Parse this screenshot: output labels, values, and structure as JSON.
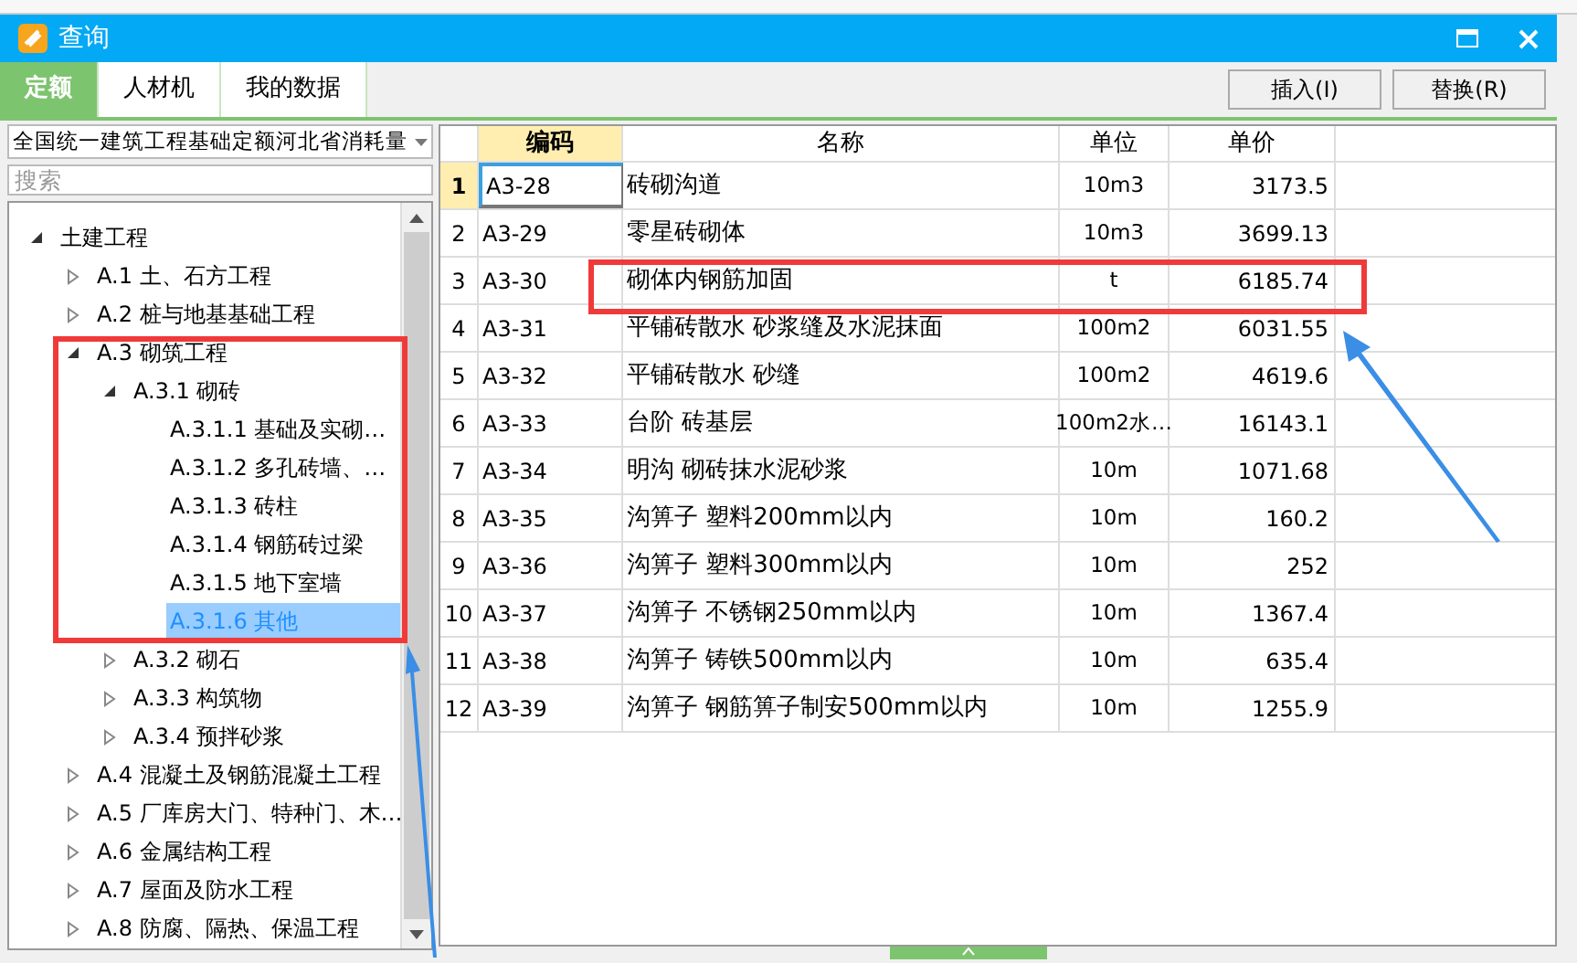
{
  "window": {
    "title": "查询"
  },
  "tabs": [
    {
      "label": "定额",
      "selected": true
    },
    {
      "label": "人材机",
      "selected": false
    },
    {
      "label": "我的数据",
      "selected": false
    }
  ],
  "buttons": [
    "插入(I)",
    "替换(R)"
  ],
  "library_select": {
    "value": "全国统一建筑工程基础定额河北省消耗量"
  },
  "search": {
    "placeholder": "搜索"
  },
  "tree": [
    {
      "label": "土建工程",
      "expanded": true,
      "selected": false,
      "children": [
        {
          "label": "A.1 土、石方工程",
          "expanded": false,
          "selected": false
        },
        {
          "label": "A.2 桩与地基基础工程",
          "expanded": false,
          "selected": false
        },
        {
          "label": "A.3 砌筑工程",
          "expanded": true,
          "selected": false,
          "children": [
            {
              "label": "A.3.1 砌砖",
              "expanded": true,
              "selected": false,
              "children": [
                {
                  "label": "A.3.1.1 基础及实砌…",
                  "selected": false
                },
                {
                  "label": "A.3.1.2 多孔砖墙、…",
                  "selected": false
                },
                {
                  "label": "A.3.1.3 砖柱",
                  "selected": false
                },
                {
                  "label": "A.3.1.4 钢筋砖过梁",
                  "selected": false
                },
                {
                  "label": "A.3.1.5 地下室墙",
                  "selected": false
                },
                {
                  "label": "A.3.1.6 其他",
                  "selected": true
                }
              ]
            },
            {
              "label": "A.3.2 砌石",
              "expanded": false,
              "selected": false
            },
            {
              "label": "A.3.3 构筑物",
              "expanded": false,
              "selected": false
            },
            {
              "label": "A.3.4 预拌砂浆",
              "expanded": false,
              "selected": false
            }
          ]
        },
        {
          "label": "A.4 混凝土及钢筋混凝土工程",
          "expanded": false,
          "selected": false
        },
        {
          "label": "A.5 厂库房大门、特种门、木…",
          "expanded": false,
          "selected": false
        },
        {
          "label": "A.6 金属结构工程",
          "expanded": false,
          "selected": false
        },
        {
          "label": "A.7 屋面及防水工程",
          "expanded": false,
          "selected": false
        },
        {
          "label": "A.8 防腐、隔热、保温工程",
          "expanded": false,
          "selected": false
        }
      ]
    }
  ],
  "table": {
    "columns": [
      {
        "label": "编码",
        "selected": true
      },
      {
        "label": "名称",
        "selected": false
      },
      {
        "label": "单位",
        "selected": false
      },
      {
        "label": "单价",
        "selected": false
      }
    ],
    "rows": [
      {
        "index": "1",
        "code": "A3-28",
        "name": "砖砌沟道",
        "unit": "10m3",
        "price": "3173.5",
        "selected": true
      },
      {
        "index": "2",
        "code": "A3-29",
        "name": "零星砖砌体",
        "unit": "10m3",
        "price": "3699.13",
        "selected": false
      },
      {
        "index": "3",
        "code": "A3-30",
        "name": "砌体内钢筋加固",
        "unit": "t",
        "price": "6185.74",
        "selected": false
      },
      {
        "index": "4",
        "code": "A3-31",
        "name": "平铺砖散水 砂浆缝及水泥抹面",
        "unit": "100m2",
        "price": "6031.55",
        "selected": false
      },
      {
        "index": "5",
        "code": "A3-32",
        "name": "平铺砖散水 砂缝",
        "unit": "100m2",
        "price": "4619.6",
        "selected": false
      },
      {
        "index": "6",
        "code": "A3-33",
        "name": "台阶 砖基层",
        "unit": "100m2水…",
        "price": "16143.1",
        "selected": false
      },
      {
        "index": "7",
        "code": "A3-34",
        "name": "明沟 砌砖抹水泥砂浆",
        "unit": "10m",
        "price": "1071.68",
        "selected": false
      },
      {
        "index": "8",
        "code": "A3-35",
        "name": "沟箅子 塑料200mm以内",
        "unit": "10m",
        "price": "160.2",
        "selected": false
      },
      {
        "index": "9",
        "code": "A3-36",
        "name": "沟箅子 塑料300mm以内",
        "unit": "10m",
        "price": "252",
        "selected": false
      },
      {
        "index": "10",
        "code": "A3-37",
        "name": "沟箅子 不锈钢250mm以内",
        "unit": "10m",
        "price": "1367.4",
        "selected": false
      },
      {
        "index": "11",
        "code": "A3-38",
        "name": "沟箅子 铸铁500mm以内",
        "unit": "10m",
        "price": "635.4",
        "selected": false
      },
      {
        "index": "12",
        "code": "A3-39",
        "name": "沟箅子 钢筋箅子制安500mm以内",
        "unit": "10m",
        "price": "1255.9",
        "selected": false
      }
    ]
  }
}
